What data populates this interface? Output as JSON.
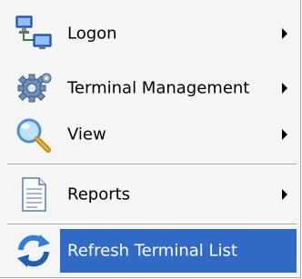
{
  "menu": {
    "items": [
      {
        "label": "Logon",
        "icon": "network-computers-icon",
        "has_submenu": true
      },
      {
        "label": "Terminal Management",
        "icon": "gears-icon",
        "has_submenu": true
      },
      {
        "label": "View",
        "icon": "magnifier-icon",
        "has_submenu": true
      },
      {
        "label": "Reports",
        "icon": "document-icon",
        "has_submenu": true
      },
      {
        "label": "Refresh Terminal List",
        "icon": "refresh-arrows-icon",
        "has_submenu": false,
        "highlighted": true
      }
    ]
  },
  "colors": {
    "highlight": "#316ac5",
    "menu_bg": "#f5f5f5"
  }
}
